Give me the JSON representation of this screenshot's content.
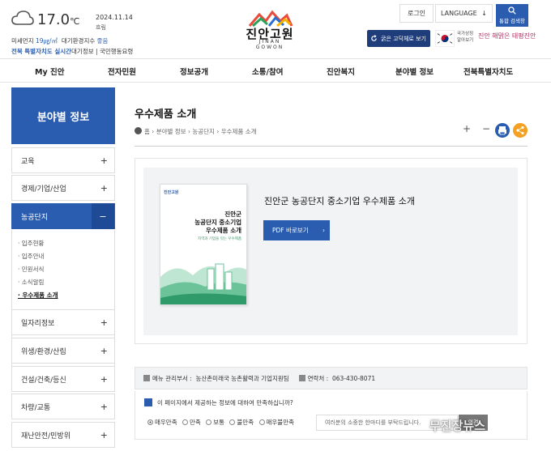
{
  "weather": {
    "temp": "17.0",
    "unit": "℃",
    "date": "2024.11.14",
    "condition": "흐림",
    "dust_label": "미세먼지",
    "dust_value": "19㎍/㎥",
    "air_label": "대기환경지수",
    "air_value": "좋음",
    "region_label": "전북",
    "region_link1": "특별자치도 실시간",
    "region_link2": "대기정보",
    "sep": "|",
    "gov_link": "국민행동요령"
  },
  "logo": {
    "title": "진안고원",
    "subtitle": "JINAN GOWON",
    "icon": "mountain-logo-icon"
  },
  "header": {
    "login": "로그인",
    "language": "LANGUAGE",
    "search_label": "통합 검색창",
    "font_button": "굵은 고딕체로 보기",
    "gov_text1": "국가상징",
    "gov_text2": "알아보기",
    "slogan": "진안 해맑은 태평진안"
  },
  "gnb": [
    "My 진안",
    "전자민원",
    "정보공개",
    "소통/참여",
    "진안복지",
    "분야별 정보",
    "전북특별자치도"
  ],
  "sidebar": {
    "title": "분야별 정보",
    "items": [
      {
        "label": "교육",
        "icon": "+"
      },
      {
        "label": "경제/기업/산업",
        "icon": "+"
      },
      {
        "label": "농공단지",
        "icon": "−"
      },
      {
        "label": "일자리정보",
        "icon": "+"
      },
      {
        "label": "위생/환경/산림",
        "icon": "+"
      },
      {
        "label": "건설/건축/등신",
        "icon": "+"
      },
      {
        "label": "차량/교통",
        "icon": "+"
      },
      {
        "label": "재난안전/민방위",
        "icon": "+"
      }
    ],
    "sub": [
      "입주현황",
      "입주안내",
      "민원서식",
      "소식알림",
      "우수제품 소개"
    ]
  },
  "page": {
    "title": "우수제품 소개",
    "crumbs": [
      "홈",
      "분야별 정보",
      "농공단지",
      "우수제품 소개"
    ],
    "sep": "›"
  },
  "tools": {
    "plus": "+",
    "minus": "−"
  },
  "product": {
    "title": "진안군 농공단지 중소기업 우수제품 소개",
    "pdf_button": "PDF 바로보기",
    "book_logo": "진안고원",
    "book_title1": "진안군",
    "book_title2": "농공단지 중소기업",
    "book_title3": "우수제품 소개",
    "book_subtitle": "지역과 기업을 잇는 우수제품"
  },
  "manager": {
    "dept_label": "메뉴 관리부서 :",
    "dept_value": "농산촌미래국 농촌활력과 기업지원팀",
    "tel_label": "연락처 :",
    "tel_value": "063-430-8071"
  },
  "survey": {
    "question": "이 페이지에서 제공하는 정보에 대하여 만족하십니까?",
    "options": [
      "매우만족",
      "만족",
      "보통",
      "불만족",
      "매우불만족"
    ],
    "placeholder": "여러분의 소중한 한마디를 부탁드립니다.",
    "submit": "의견"
  },
  "watermark": "무진장뉴스"
}
